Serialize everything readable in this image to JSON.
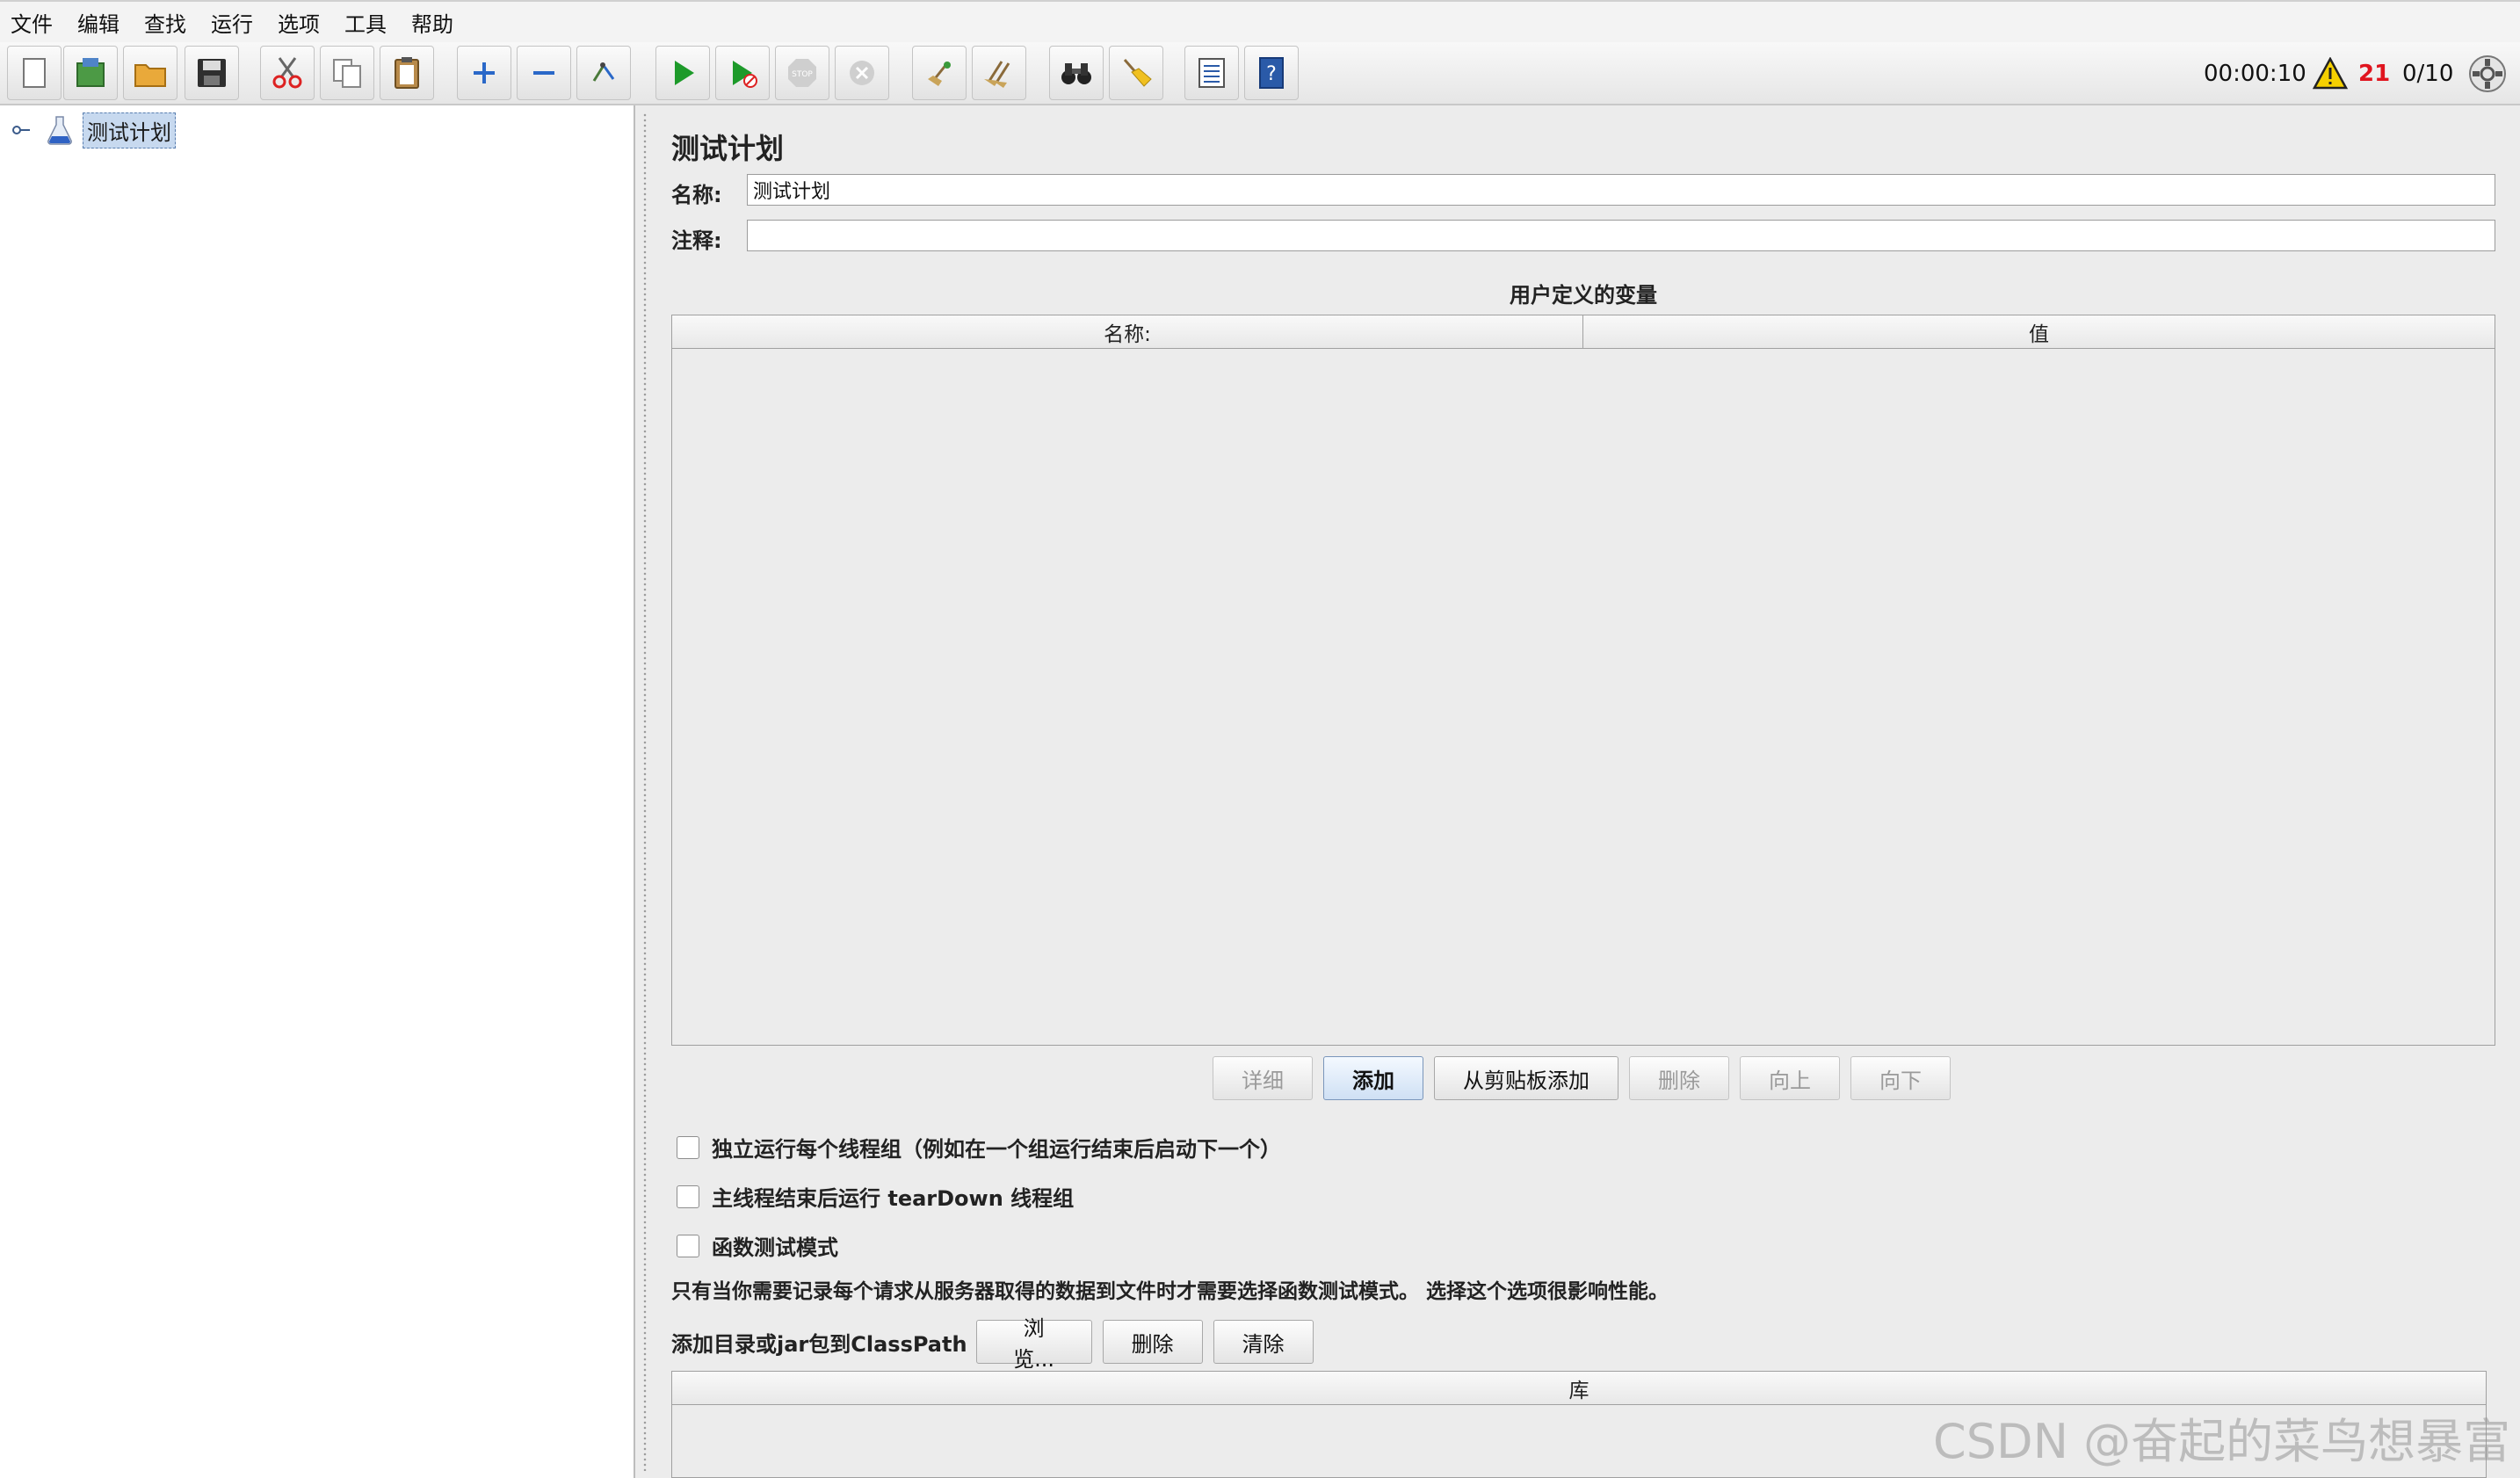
{
  "menubar": {
    "items": [
      "文件",
      "编辑",
      "查找",
      "运行",
      "选项",
      "工具",
      "帮助"
    ]
  },
  "toolbar": {
    "buttons": [
      {
        "name": "new-icon",
        "tooltip": ""
      },
      {
        "name": "templates-icon",
        "tooltip": ""
      },
      {
        "name": "open-folder-icon",
        "tooltip": ""
      },
      {
        "name": "save-icon",
        "tooltip": ""
      },
      {
        "name": "cut-icon",
        "tooltip": ""
      },
      {
        "name": "copy-icon",
        "tooltip": ""
      },
      {
        "name": "paste-icon",
        "tooltip": ""
      },
      {
        "name": "expand-plus-icon",
        "tooltip": ""
      },
      {
        "name": "collapse-minus-icon",
        "tooltip": ""
      },
      {
        "name": "toggle-icon",
        "tooltip": ""
      },
      {
        "name": "start-icon",
        "tooltip": ""
      },
      {
        "name": "start-no-pauses-icon",
        "tooltip": ""
      },
      {
        "name": "stop-icon",
        "tooltip": ""
      },
      {
        "name": "shutdown-icon",
        "tooltip": ""
      },
      {
        "name": "clear-icon",
        "tooltip": ""
      },
      {
        "name": "clear-all-icon",
        "tooltip": ""
      },
      {
        "name": "search-binoculars-icon",
        "tooltip": ""
      },
      {
        "name": "reset-search-broom-icon",
        "tooltip": ""
      },
      {
        "name": "function-helper-list-icon",
        "tooltip": ""
      },
      {
        "name": "help-icon",
        "tooltip": ""
      }
    ],
    "status": {
      "timer": "00:00:10",
      "warning_icon": "warning-triangle-icon",
      "warning_count": "21",
      "threads": "0/10"
    }
  },
  "tree": {
    "root_label": "测试计划"
  },
  "main": {
    "title": "测试计划",
    "name_label": "名称:",
    "name_value": "测试计划",
    "comment_label": "注释:",
    "comment_value": "",
    "vars_title": "用户定义的变量",
    "vars_columns": [
      "名称:",
      "值"
    ],
    "vars_buttons": [
      {
        "label": "详细",
        "enabled": false
      },
      {
        "label": "添加",
        "enabled": true
      },
      {
        "label": "从剪贴板添加",
        "enabled": true
      },
      {
        "label": "删除",
        "enabled": false
      },
      {
        "label": "向上",
        "enabled": false
      },
      {
        "label": "向下",
        "enabled": false
      }
    ],
    "checkboxes": [
      {
        "label": "独立运行每个线程组（例如在一个组运行结束后启动下一个）",
        "checked": false
      },
      {
        "label": "主线程结束后运行 tearDown 线程组",
        "checked": false
      },
      {
        "label": "函数测试模式",
        "checked": false
      }
    ],
    "functional_note": "只有当你需要记录每个请求从服务器取得的数据到文件时才需要选择函数测试模式。 选择这个选项很影响性能。",
    "classpath_label": "添加目录或jar包到ClassPath",
    "classpath_buttons": [
      "浏览...",
      "删除",
      "清除"
    ],
    "lib_column": "库"
  },
  "watermark": "CSDN @奋起的菜鸟想暴富"
}
